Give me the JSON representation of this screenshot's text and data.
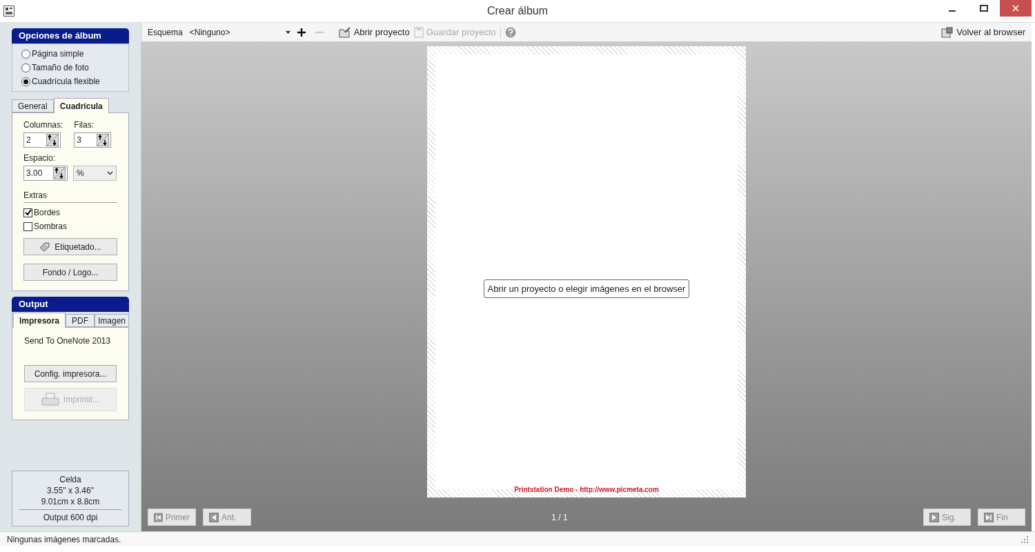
{
  "window": {
    "title": "Crear álbum"
  },
  "album_options": {
    "title": "Opciones de álbum",
    "layouts": [
      {
        "label": "Página simple",
        "selected": false
      },
      {
        "label": "Tamaño de foto",
        "selected": false
      },
      {
        "label": "Cuadrícula flexible",
        "selected": true
      }
    ]
  },
  "settings_tabs": [
    {
      "label": "General",
      "selected": false
    },
    {
      "label": "Cuadrícula",
      "selected": true
    }
  ],
  "grid": {
    "columns_label": "Columnas:",
    "columns_value": "2",
    "rows_label": "Filas:",
    "rows_value": "3",
    "spacing_label": "Espacio:",
    "spacing_value": "3.00",
    "spacing_unit": "%",
    "extras_label": "Extras",
    "extras": [
      {
        "label": "Bordes",
        "checked": true
      },
      {
        "label": "Sombras",
        "checked": false
      }
    ],
    "labeling_button": "Etiquetado...",
    "background_button": "Fondo / Logo..."
  },
  "output": {
    "title": "Output",
    "tabs": [
      {
        "label": "Impresora",
        "selected": true
      },
      {
        "label": "PDF",
        "selected": false
      },
      {
        "label": "Imagen",
        "selected": false
      }
    ],
    "printer_name": "Send To OneNote 2013",
    "setup_button": "Config. impresora...",
    "print_button": {
      "label": "Imprimir...",
      "disabled": true
    }
  },
  "cell_info": {
    "title": "Celda",
    "inches": "3.55\" x 3.46\"",
    "cm": "9.01cm x 8.8cm",
    "dpi": "Output 600 dpi"
  },
  "toolbar": {
    "scheme_label": "Esquema",
    "scheme_value": "<Ninguno>",
    "open_project": {
      "label": "Abrir proyecto",
      "disabled": false
    },
    "save_project": {
      "label": "Guardar proyecto",
      "disabled": true
    },
    "back_to_browser": "Volver al browser"
  },
  "canvas": {
    "hint": "Abrir un proyecto o elegir imágenes en el browser",
    "watermark": "Printstation Demo - http://www.picmeta.com"
  },
  "navigation": {
    "buttons": [
      {
        "kind": "first",
        "label": "Primer",
        "disabled": true
      },
      {
        "kind": "previous",
        "label": "Ant.",
        "disabled": true
      },
      {
        "kind": "next",
        "label": "Sig.",
        "disabled": true
      },
      {
        "kind": "last",
        "label": "Fin",
        "disabled": true
      }
    ],
    "page": "1 / 1"
  },
  "status_bar": "Ningunas imágenes marcadas."
}
